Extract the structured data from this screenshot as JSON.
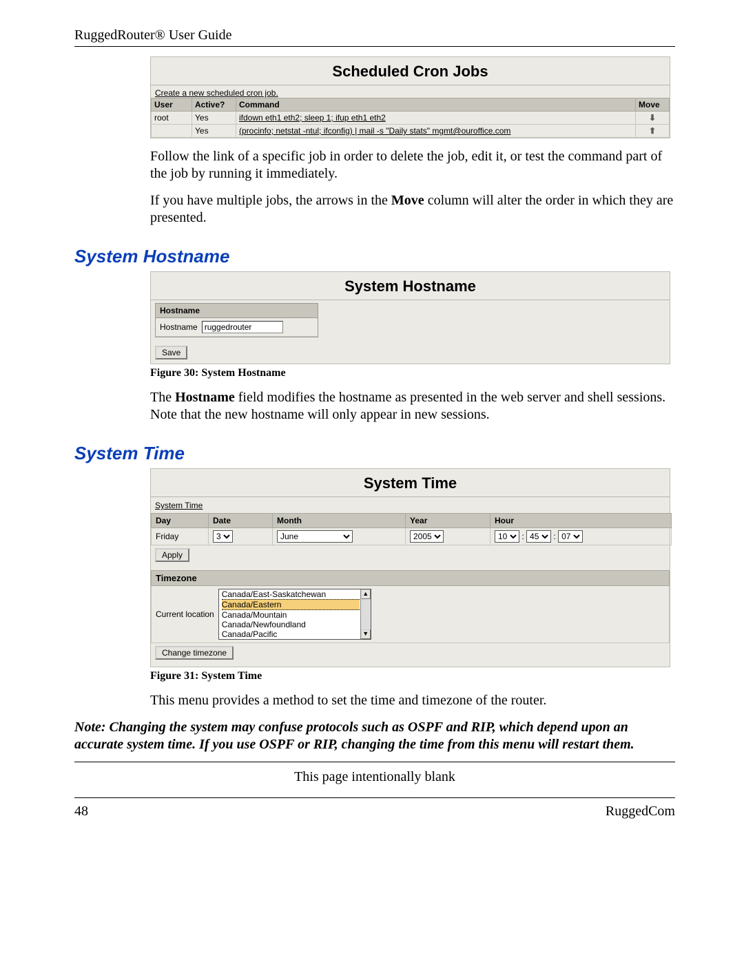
{
  "header": {
    "title": "RuggedRouter® User Guide"
  },
  "cron": {
    "title": "Scheduled Cron Jobs",
    "create_link": "Create a new scheduled cron job.",
    "columns": {
      "user": "User",
      "active": "Active?",
      "command": "Command",
      "move": "Move"
    },
    "rows": [
      {
        "user": "root",
        "active": "Yes",
        "command": "ifdown eth1 eth2; sleep 1; ifup eth1 eth2"
      },
      {
        "user": "",
        "active": "Yes",
        "command": "(procinfo; netstat -ntul; ifconfig) | mail -s \"Daily stats\" mgmt@ouroffice.com"
      }
    ]
  },
  "para1": "Follow the link of a specific job in order to delete the job, edit it, or test the command part of the job by running it immediately.",
  "para2a": "If you have multiple jobs, the arrows in the ",
  "para2b": "Move",
  "para2c": " column will alter the order in which they are presented.",
  "hostname_section": {
    "heading": "System Hostname",
    "ui_title": "System Hostname",
    "panel_label": "Hostname",
    "field_label": "Hostname",
    "field_value": "ruggedrouter",
    "save_label": "Save",
    "fig_caption": "Figure 30: System Hostname",
    "desc_a": "The ",
    "desc_b": "Hostname",
    "desc_c": " field modifies the hostname as presented in the web server and shell sessions.  Note that the new hostname will only appear in new sessions."
  },
  "time_section": {
    "heading": "System Time",
    "ui_title": "System Time",
    "link": "System Time",
    "columns": {
      "day": "Day",
      "date": "Date",
      "month": "Month",
      "year": "Year",
      "hour": "Hour"
    },
    "values": {
      "day": "Friday",
      "date": "3",
      "month": "June",
      "year": "2005",
      "h": "10",
      "m": "45",
      "s": "07"
    },
    "apply_label": "Apply",
    "tz_header": "Timezone",
    "tz_label": "Current location",
    "tz_options": [
      "Canada/East-Saskatchewan",
      "Canada/Eastern",
      "Canada/Mountain",
      "Canada/Newfoundland",
      "Canada/Pacific"
    ],
    "change_tz_label": "Change timezone",
    "fig_caption": "Figure 31: System Time",
    "desc": "This menu provides a method to set the time and timezone of the router."
  },
  "note": "Note:  Changing the system may confuse protocols such as OSPF and RIP, which depend upon an accurate system time.  If you use OSPF or RIP, changing the time from this menu will restart them.",
  "blank": "This page intentionally blank",
  "footer": {
    "page": "48",
    "company": "RuggedCom"
  }
}
